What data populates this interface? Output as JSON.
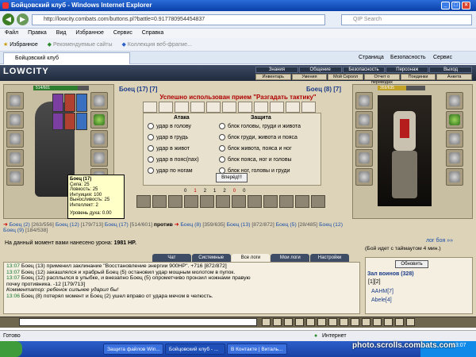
{
  "window": {
    "title": "Бойцовский клуб - Windows Internet Explorer"
  },
  "address": {
    "url": "http://lowcity.combats.com/buttons.pl?battle=0.917780954454837",
    "search_placeholder": "QIP Search"
  },
  "menu": [
    "Файл",
    "Правка",
    "Вид",
    "Избранное",
    "Сервис",
    "Справка"
  ],
  "favbar": {
    "favorites": "Избранное",
    "recommended": "Рекомендуемые сайты",
    "gallery": "Коллекция веб-фрагме..."
  },
  "tab": {
    "title": "Бойцовский клуб"
  },
  "ie_tools": [
    "Страница",
    "Безопасность",
    "Сервис"
  ],
  "game": {
    "logo": "LOWCITY",
    "topnav": [
      "Знания",
      "Общение",
      "Безопасность",
      "Персонаж",
      "Выход"
    ],
    "subnav": [
      "Инвентарь",
      "Умения",
      "Мой Скролл",
      "Отчет о переводах",
      "Поединки",
      "Анкета"
    ],
    "left_fighter": {
      "name": "Боец (17) [7]",
      "hp": "514/601"
    },
    "right_fighter": {
      "name": "Боец (8) [7]",
      "hp": "359/635"
    },
    "message": "Успешно использован прием \"Разгадать тактику\"",
    "attack_header": "Атака",
    "defense_header": "Защита",
    "attacks": [
      "удар в голову",
      "удар в грудь",
      "удар в живот",
      "удар в пояс(пах)",
      "удар по ногам"
    ],
    "defenses": [
      "блок головы, груди и живота",
      "блок груди, живота и пояса",
      "блок живота, пояса и ног",
      "блок пояса, ног и головы",
      "блок ног, головы и груди"
    ],
    "go_button": "Вперёд!!!",
    "stats": [
      "0",
      "1",
      "2",
      "1",
      "2",
      "0",
      "0"
    ],
    "tooltip": {
      "name": "Боец (17)",
      "lines": [
        "Сила: 25",
        "Ловкость: 25",
        "Интуиция: 100",
        "Выносливость: 25",
        "Интеллект: 2"
      ],
      "spirit": "Уровень духа: 0.00"
    },
    "versus": {
      "left": [
        {
          "name": "Боец (2)",
          "hp": "[263/556]"
        },
        {
          "name": "Боец (12)",
          "hp": "[179/713]"
        },
        {
          "name": "Боец (17)",
          "hp": "[514/601]"
        }
      ],
      "vs": "против",
      "right": [
        {
          "name": "Боец (8)",
          "hp": "[359/635]"
        },
        {
          "name": "Боец (13)",
          "hp": "[872/872]"
        },
        {
          "name": "Боец (5)",
          "hp": "[28/485]"
        },
        {
          "name": "Боец (12)",
          "hp": ""
        },
        {
          "name": "Боец (9)",
          "hp": "[184/538]"
        }
      ]
    },
    "damage_text": "На данный момент вами нанесено урона:",
    "damage_value": "1981 HP.",
    "battle_log_link": "лог боя »»",
    "timeout_text": "(Бой идет с таймаутом 4 мин.)",
    "log_tabs": [
      "Чат",
      "Системные сообщения",
      "Все логи",
      "Мои логи",
      "Настройки"
    ],
    "log_lines": [
      {
        "time": "13:07",
        "text": "Боец (13) применил заклинание \"Восстановление энергии 900HP\". +716 [872/872]"
      },
      {
        "time": "13:07",
        "text": "Боец (12) закашлялся и храбрый Боец (5) остановил удар мощным молотом в пупок."
      },
      {
        "time": "13:07",
        "text": "Боец (12) расплылся в улыбке, и внезапно Боец (5) опрометчиво пронзил ножнами правую"
      },
      {
        "time": "",
        "text": "почку противника. -12 [179/713]"
      },
      {
        "time": "",
        "text": "Комментатор: ребенок сильнее ударил бы!"
      },
      {
        "time": "13:06",
        "text": "Боец (8) потерял момент и Боец (2) ушел вправо от удара мечом в челюсть."
      }
    ],
    "side": {
      "refresh": "Обновить",
      "room": "Зал воинов (328)",
      "pages": "[1][2]",
      "users": [
        "AAHM[7]",
        "Abele[4]"
      ]
    }
  },
  "status": {
    "left": "Готово",
    "zone": "Интернет"
  },
  "taskbar": {
    "tasks": [
      "Защита файлов Win...",
      "Бойцовский клуб - ...",
      "В Контакте | Виталь..."
    ],
    "watermark": "photo.scrolls.combats.com",
    "clock": "13:07"
  }
}
